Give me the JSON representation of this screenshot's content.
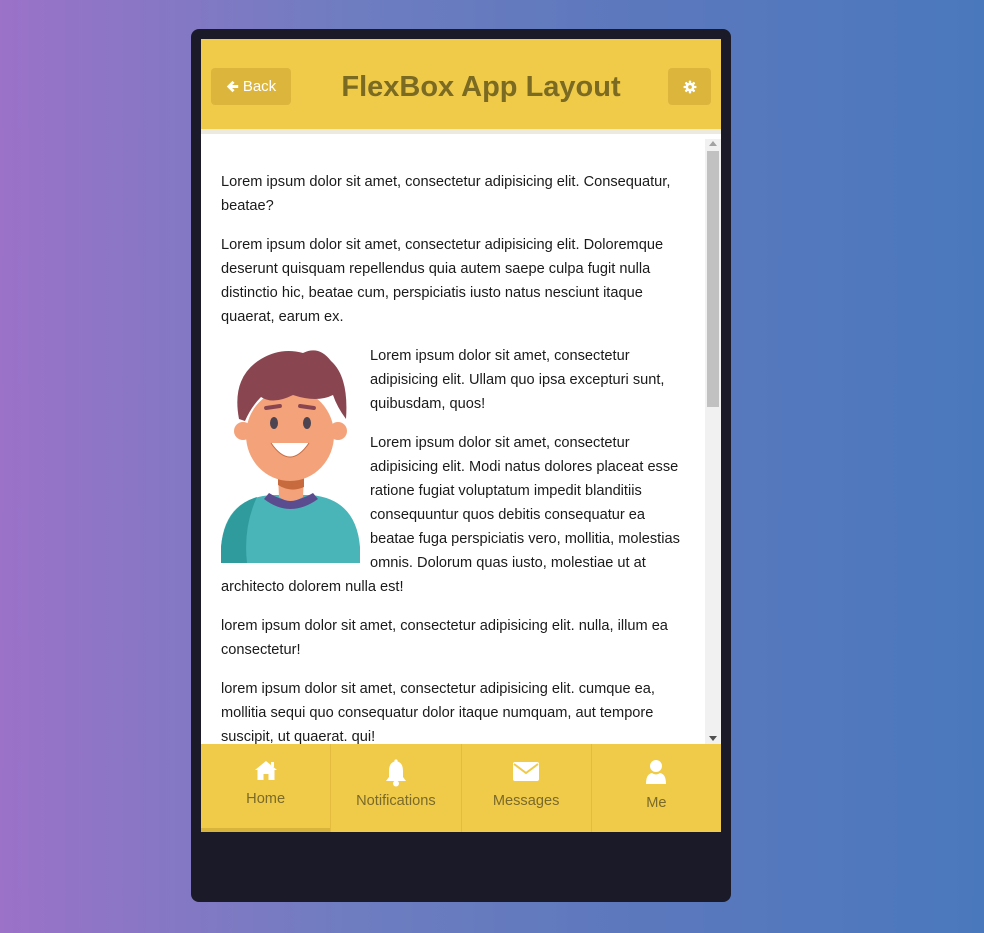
{
  "header": {
    "back_label": "Back",
    "title": "FlexBox App Layout"
  },
  "content": {
    "paragraphs_top": [
      "Lorem ipsum dolor sit amet, consectetur adipisicing elit. Consequatur, beatae?",
      "Lorem ipsum dolor sit amet, consectetur adipisicing elit. Doloremque deserunt quisquam repellendus quia autem saepe culpa fugit nulla distinctio hic, beatae cum, perspiciatis iusto natus nesciunt itaque quaerat, earum ex."
    ],
    "paragraphs_wrap": [
      "Lorem ipsum dolor sit amet, consectetur adipisicing elit. Ullam quo ipsa excepturi sunt, quibusdam, quos!",
      "Lorem ipsum dolor sit amet, consectetur adipisicing elit. Modi natus dolores placeat esse ratione fugiat voluptatum impedit blanditiis consequuntur quos debitis consequatur ea beatae fuga perspiciatis vero, mollitia, molestias omnis. Dolorum quas iusto, molestiae ut at architecto dolorem nulla est!"
    ],
    "paragraphs_bottom": [
      "lorem ipsum dolor sit amet, consectetur adipisicing elit. nulla, illum ea consectetur!",
      "lorem ipsum dolor sit amet, consectetur adipisicing elit. cumque ea, mollitia sequi quo consequatur dolor itaque numquam, aut tempore suscipit, ut quaerat. qui!"
    ]
  },
  "tabs": [
    {
      "label": "Home",
      "icon": "home-icon"
    },
    {
      "label": "Notifications",
      "icon": "bell-icon"
    },
    {
      "label": "Messages",
      "icon": "envelope-icon"
    },
    {
      "label": "Me",
      "icon": "user-icon"
    }
  ],
  "colors": {
    "accent": "#f0ca49",
    "title": "#7a6a22",
    "device": "#1b1a28"
  }
}
